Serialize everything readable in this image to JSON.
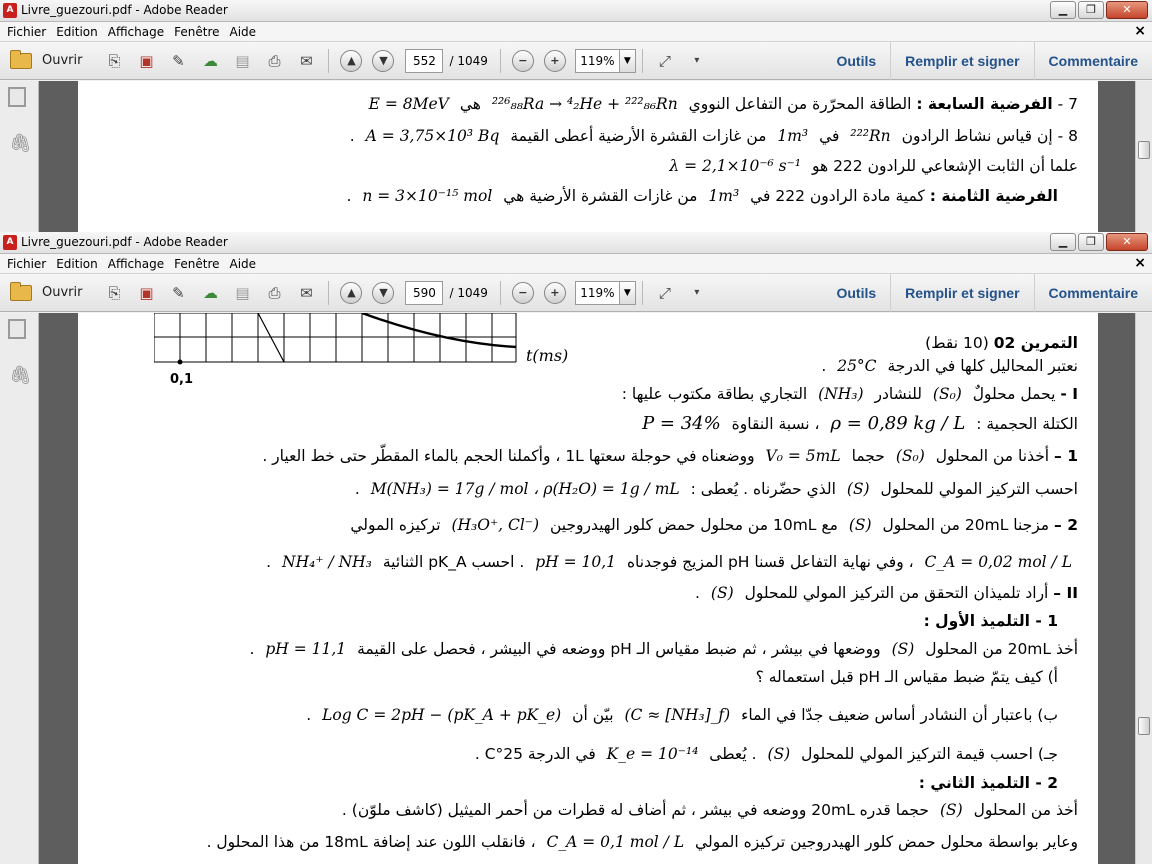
{
  "windows": [
    {
      "title": "Livre_guezouri.pdf - Adobe Reader",
      "menu": [
        "Fichier",
        "Edition",
        "Affichage",
        "Fenêtre",
        "Aide"
      ],
      "toolbar": {
        "open_label": "Ouvrir",
        "page_current": "552",
        "page_total": "/ 1049",
        "zoom": "119%",
        "right_links": [
          "Outils",
          "Remplir et signer",
          "Commentaire"
        ]
      },
      "lines": [
        {
          "num": "7 -",
          "label": "الفرضية السابعة :",
          "text": "الطاقة المحرّرة من التفاعل النووي",
          "math": "²²⁶₈₈Ra → ⁴₂He + ²²²₈₆Rn",
          "text2": "هي",
          "math2": "E = 8MeV"
        },
        {
          "num": "8 -",
          "text": "إن قياس نشاط الرادون",
          "math": "²²²Rn",
          "text2": "في",
          "math2": "1m³",
          "text3": "من غازات القشرة الأرضية أعطى القيمة",
          "math3": "A = 3,75×10³ Bq",
          "end": "."
        },
        {
          "text": "علما أن الثابت الإشعاعي للرادون 222 هو",
          "math": "λ = 2,1×10⁻⁶ s⁻¹"
        },
        {
          "label": "الفرضية الثامنة :",
          "text": "كمية مادة الرادون 222 في",
          "math": "1m³",
          "text2": "من غازات القشرة الأرضية هي",
          "math2": "n = 3×10⁻¹⁵ mol",
          "end": "."
        }
      ]
    },
    {
      "title": "Livre_guezouri.pdf - Adobe Reader",
      "menu": [
        "Fichier",
        "Edition",
        "Affichage",
        "Fenêtre",
        "Aide"
      ],
      "toolbar": {
        "open_label": "Ouvrir",
        "page_current": "590",
        "page_total": "/ 1049",
        "zoom": "119%",
        "right_links": [
          "Outils",
          "Remplir et signer",
          "Commentaire"
        ]
      },
      "graph": {
        "x_label": "t(ms)",
        "tick_label": "0,1"
      },
      "lines": [
        {
          "label": "التمرين 02",
          "text": "(10 نقط)"
        },
        {
          "text": "نعتبر المحاليل كلها في الدرجة",
          "math": "25°C",
          "end": "."
        },
        {
          "num": "I -",
          "text": "يحمل محلولٌ",
          "math": "(S₀)",
          "text2": "للنشادر",
          "math2": "(NH₃)",
          "text3": "التجاري بطاقة مكتوب عليها :"
        },
        {
          "text": "الكتلة الحجمية :",
          "math": "ρ = 0,89 kg / L",
          "text2": "، نسبة النقاوة",
          "math2": "P = 34%"
        },
        {
          "num": "1 –",
          "text": "أخذنا من المحلول",
          "math": "(S₀)",
          "text2": "حجما",
          "math2": "V₀ = 5mL",
          "text3": "ووضعناه في حوجلة سعتها 1L ، وأكملنا الحجم بالماء المقطّر حتى خط العيار ."
        },
        {
          "text": "احسب التركيز المولي للمحلول",
          "math": "(S)",
          "text2": "الذي حضّرناه .   يُعطى :",
          "math2": "M(NH₃) = 17g / mol   ،   ρ(H₂O) = 1g / mL",
          "end": "."
        },
        {
          "num": "2 –",
          "text": "مزجنا 20mL من المحلول",
          "math": "(S)",
          "text2": "مع 10mL من محلول حمض كلور الهيدروجين",
          "math2": "(H₃O⁺, Cl⁻)",
          "text3": "تركيزه المولي"
        },
        {
          "math": "C_A = 0,02 mol / L",
          "text": "، وفي نهاية التفاعل قسنا pH المزيج فوجدناه",
          "math2": "pH = 10,1",
          "text2": ". احسب pK_A الثنائية",
          "math3": "NH₄⁺ / NH₃",
          "end": "."
        },
        {
          "num": "II –",
          "text": "أراد تلميذان التحقق من التركيز المولي للمحلول",
          "math": "(S)",
          "end": "."
        },
        {
          "label": "1 - التلميذ الأول :"
        },
        {
          "text": "أخذ 20mL من المحلول",
          "math": "(S)",
          "text2": "ووضعها في بيشر ، ثم ضبط مقياس الـ pH ووضعه في البيشر ، فحصل على القيمة",
          "math2": "pH = 11,1",
          "end": "."
        },
        {
          "text": "أ) كيف يتمّ ضبط مقياس الـ pH قبل استعماله ؟"
        },
        {
          "text": "ب) باعتبار أن النشادر أساس ضعيف جدّا في الماء",
          "math": "(C ≈ [NH₃]_f)",
          "text2": "بيّن أن",
          "math2": "Log C = 2pH − (pK_A + pK_e)",
          "end": "."
        },
        {
          "text": "جـ) احسب قيمة التركيز المولي للمحلول",
          "math": "(S)",
          "text2": ". يُعطى",
          "math2": "K_e = 10⁻¹⁴",
          "text3": "في الدرجة 25°C",
          "end": "."
        },
        {
          "label": "2 - التلميذ الثاني :"
        },
        {
          "text": "أخذ من المحلول",
          "math": "(S)",
          "text2": "حجما قدره 20mL ووضعه في بيشر ، ثم أضاف له قطرات من أحمر الميثيل (كاشف ملوّن) ."
        },
        {
          "text": "وعاير بواسطة محلول حمض كلور الهيدروجين تركيزه المولي",
          "math": "C_A = 0,1 mol / L",
          "text2": "، فانقلب اللون عند إضافة 18mL من هذا المحلول ."
        }
      ]
    }
  ]
}
